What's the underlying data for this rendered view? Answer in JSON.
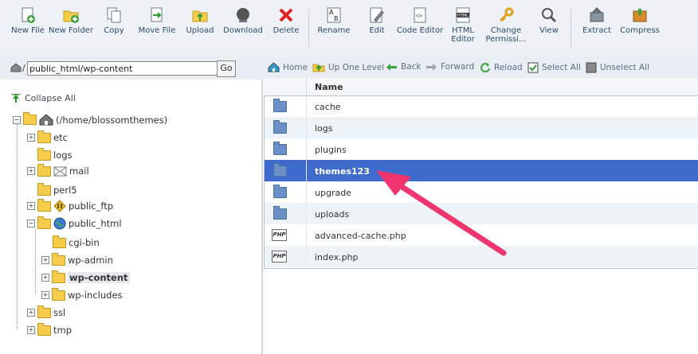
{
  "toolbar": {
    "new_file": "New File",
    "new_folder": "New Folder",
    "copy": "Copy",
    "move_file": "Move File",
    "upload": "Upload",
    "download": "Download",
    "delete": "Delete",
    "rename": "Rename",
    "edit": "Edit",
    "code_editor": "Code Editor",
    "html_editor": "HTML Editor",
    "change_permissions": "Change Permissi...",
    "view": "View",
    "extract": "Extract",
    "compress": "Compress"
  },
  "path": {
    "value": "public_html/wp-content",
    "go": "Go"
  },
  "nav": {
    "home": "Home",
    "up_one_level": "Up One Level",
    "back": "Back",
    "forward": "Forward",
    "reload": "Reload",
    "select_all": "Select All",
    "unselect_all": "Unselect All"
  },
  "tree": {
    "collapse_all": "Collapse All",
    "root": "(/home/blossomthemes)",
    "etc": "etc",
    "logs": "logs",
    "mail": "mail",
    "perl5": "perl5",
    "public_ftp": "public_ftp",
    "public_html": "public_html",
    "cgi_bin": "cgi-bin",
    "wp_admin": "wp-admin",
    "wp_content": "wp-content",
    "wp_includes": "wp-includes",
    "ssl": "ssl",
    "tmp": "tmp"
  },
  "table": {
    "header_name": "Name",
    "rows": [
      {
        "name": "cache",
        "type": "folder"
      },
      {
        "name": "logs",
        "type": "folder"
      },
      {
        "name": "plugins",
        "type": "folder"
      },
      {
        "name": "themes123",
        "type": "folder"
      },
      {
        "name": "upgrade",
        "type": "folder"
      },
      {
        "name": "uploads",
        "type": "folder"
      },
      {
        "name": "advanced-cache.php",
        "type": "php"
      },
      {
        "name": "index.php",
        "type": "php"
      }
    ],
    "php_icon_label": "PHP"
  },
  "colors": {
    "selected_row": "#3f6ccc",
    "annotation_arrow": "#f0346e"
  }
}
